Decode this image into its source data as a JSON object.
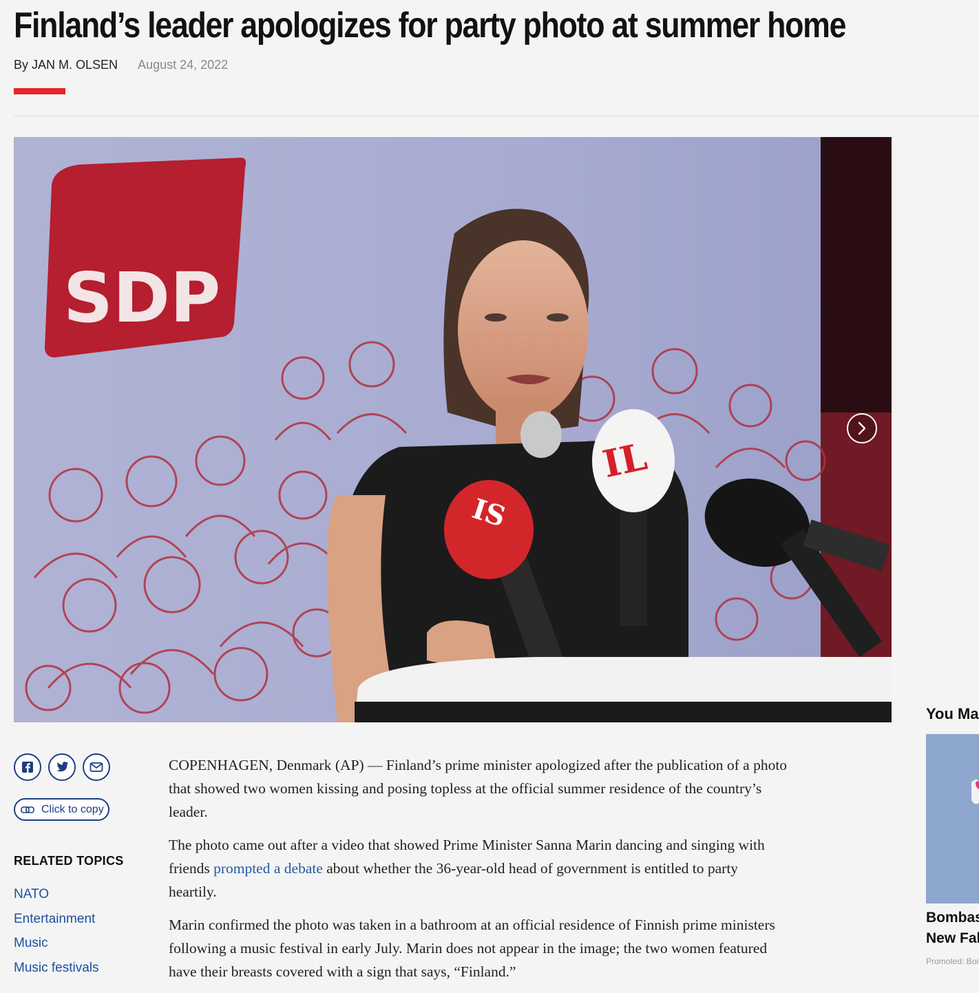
{
  "article": {
    "headline": "Finland’s leader apologizes for party photo at summer home",
    "byline": "By JAN M. OLSEN",
    "date": "August 24, 2022",
    "paragraphs": [
      {
        "text": "COPENHAGEN, Denmark (AP) — Finland’s prime minister apologized after the publication of a photo that showed two women kissing and posing topless at the official summer residence of the country’s leader."
      },
      {
        "before": "The photo came out after a video that showed Prime Minister Sanna Marin dancing and singing with friends ",
        "link": "prompted a debate",
        "after": " about whether the 36-year-old head of government is entitled to party heartily."
      },
      {
        "text": "Marin confirmed the photo was taken in a bathroom at an official residence of Finnish prime ministers following a music festival in early July. Marin does not appear in the image; the two women featured have their breasts covered with a sign that says, “Finland.”"
      }
    ]
  },
  "hero": {
    "logo_text": "SDP",
    "mic_labels": [
      "IS",
      "IL"
    ],
    "next_icon": "chevron-right-icon"
  },
  "share": {
    "icons": [
      "facebook-icon",
      "twitter-icon",
      "email-icon"
    ],
    "copy_label": "Click to copy"
  },
  "related": {
    "title": "RELATED TOPICS",
    "topics": [
      "NATO",
      "Entertainment",
      "Music",
      "Music festivals"
    ]
  },
  "rail": {
    "title": "You May",
    "item_title_lines": [
      "Bombas",
      "New Fall"
    ],
    "promoted": "Promoted: Bom"
  },
  "colors": {
    "accent_red": "#e8232a",
    "link_blue": "#2359a6",
    "brand_navy": "#1b3f82",
    "sdp_red": "#b51f2f"
  }
}
